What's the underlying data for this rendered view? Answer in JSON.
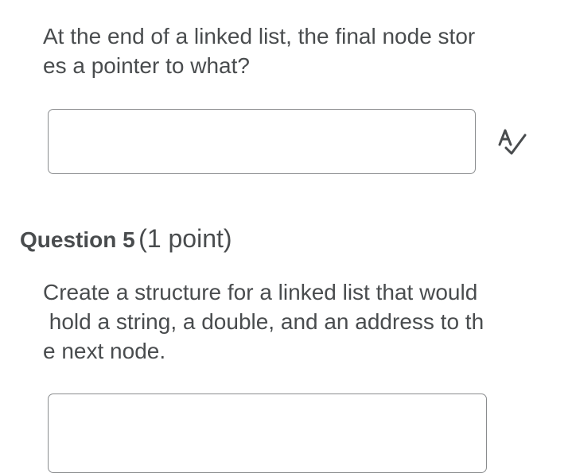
{
  "question4": {
    "prompt_lines": [
      "At the end of a linked list, the final node stor",
      "es a pointer to what?"
    ],
    "answer_value": "",
    "spellcheck_icon": "spellcheck-icon"
  },
  "question5": {
    "title": "Question 5",
    "points": "(1 point)",
    "prompt_lines": [
      "Create a structure for a linked list that would",
      " hold a string, a double, and an address to th",
      "e next node."
    ],
    "answer_value": ""
  },
  "colors": {
    "text": "#494c4e",
    "input_border": "#8a8c8e",
    "background": "#ffffff"
  }
}
